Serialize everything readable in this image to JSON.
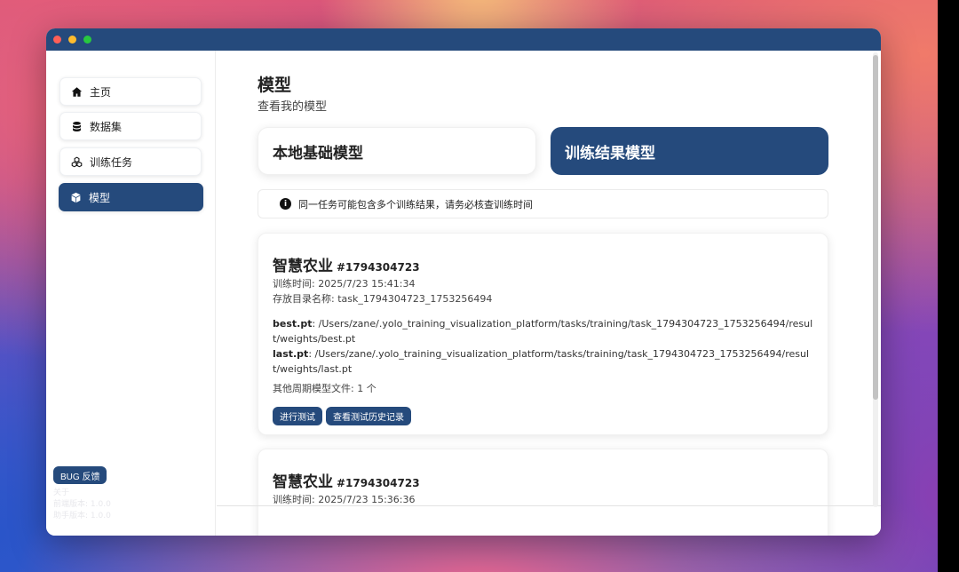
{
  "window": {
    "controls": [
      "close",
      "minimize",
      "maximize"
    ]
  },
  "sidebar": {
    "items": [
      {
        "label": "主页",
        "icon": "home-icon",
        "active": false
      },
      {
        "label": "数据集",
        "icon": "database-icon",
        "active": false
      },
      {
        "label": "训练任务",
        "icon": "cubes-icon",
        "active": false
      },
      {
        "label": "模型",
        "icon": "cube-icon",
        "active": true
      }
    ],
    "bug_button": "BUG 反馈",
    "about": "关于",
    "frontend_version": "前端版本: 1.0.0",
    "helper_version": "助手版本: 1.0.0"
  },
  "main": {
    "title": "模型",
    "subtitle": "查看我的模型",
    "tabs": [
      {
        "label": "本地基础模型",
        "active": false
      },
      {
        "label": "训练结果模型",
        "active": true
      }
    ],
    "notice": "同一任务可能包含多个训练结果，请务必核查训练时间",
    "cards": [
      {
        "name": "智慧农业",
        "task_no": "#1794304723",
        "train_time": "训练时间: 2025/7/23 15:41:34",
        "dir_name": "存放目录名称: task_1794304723_1753256494",
        "best_label": "best.pt",
        "best_path": ": /Users/zane/.yolo_training_visualization_platform/tasks/training/task_1794304723_1753256494/result/weights/best.pt",
        "last_label": "last.pt",
        "last_path": ": /Users/zane/.yolo_training_visualization_platform/tasks/training/task_1794304723_1753256494/result/weights/last.pt",
        "other_files": "其他周期模型文件: 1 个",
        "test_button": "进行测试",
        "history_button": "查看测试历史记录"
      },
      {
        "name": "智慧农业",
        "task_no": "#1794304723",
        "train_time": "训练时间: 2025/7/23 15:36:36"
      }
    ]
  },
  "colors": {
    "primary": "#254a7c",
    "window_bg": "#ffffff"
  }
}
